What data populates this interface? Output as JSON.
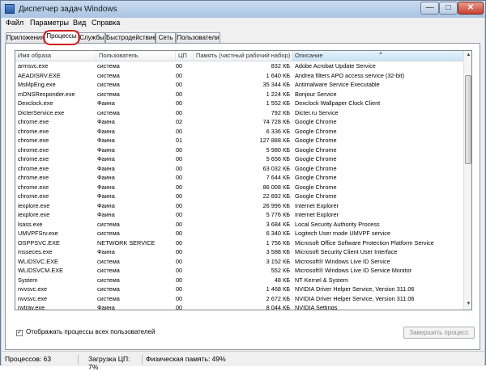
{
  "window": {
    "title": "Диспетчер задач Windows",
    "min": "—",
    "max": "□",
    "close": "✕"
  },
  "menu": [
    "Файл",
    "Параметры",
    "Вид",
    "Справка"
  ],
  "tabs": [
    "Приложения",
    "Процессы",
    "Службы",
    "Быстродействие",
    "Сеть",
    "Пользователи"
  ],
  "active_tab": "Процессы",
  "columns": {
    "name": "Имя образа",
    "user": "Пользователь",
    "cpu": "ЦП",
    "mem": "Память (частный рабочий набор)",
    "desc": "Описание"
  },
  "processes": [
    [
      "armsvc.exe",
      "система",
      "00",
      "832 КБ",
      "Adobe Acrobat Update Service"
    ],
    [
      "AEADISRV.EXE",
      "система",
      "00",
      "1 640 КБ",
      "Andrea filters APO access service (32-bit)"
    ],
    [
      "MsMpEng.exe",
      "система",
      "00",
      "35 344 КБ",
      "Antimalware Service Executable"
    ],
    [
      "mDNSResponder.exe",
      "система",
      "00",
      "1 224 КБ",
      "Bonjour Service"
    ],
    [
      "Dexclock.exe",
      "Фаина",
      "00",
      "1 552 КБ",
      "Dexclock Wallpaper Clock Client"
    ],
    [
      "DicterService.exe",
      "система",
      "00",
      "792 КБ",
      "Dicter.ru Service"
    ],
    [
      "chrome.exe",
      "Фаина",
      "02",
      "74 728 КБ",
      "Google Chrome"
    ],
    [
      "chrome.exe",
      "Фаина",
      "00",
      "6 336 КБ",
      "Google Chrome"
    ],
    [
      "chrome.exe",
      "Фаина",
      "01",
      "127 888 КБ",
      "Google Chrome"
    ],
    [
      "chrome.exe",
      "Фаина",
      "00",
      "5 980 КБ",
      "Google Chrome"
    ],
    [
      "chrome.exe",
      "Фаина",
      "00",
      "5 656 КБ",
      "Google Chrome"
    ],
    [
      "chrome.exe",
      "Фаина",
      "00",
      "63 032 КБ",
      "Google Chrome"
    ],
    [
      "chrome.exe",
      "Фаина",
      "00",
      "7 644 КБ",
      "Google Chrome"
    ],
    [
      "chrome.exe",
      "Фаина",
      "00",
      "86 008 КБ",
      "Google Chrome"
    ],
    [
      "chrome.exe",
      "Фаина",
      "00",
      "22 892 КБ",
      "Google Chrome"
    ],
    [
      "iexplore.exe",
      "Фаина",
      "00",
      "26 996 КБ",
      "Internet Explorer"
    ],
    [
      "iexplore.exe",
      "Фаина",
      "00",
      "5 776 КБ",
      "Internet Explorer"
    ],
    [
      "lsass.exe",
      "система",
      "00",
      "3 684 КБ",
      "Local Security Authority Process"
    ],
    [
      "UMVPFSrv.exe",
      "система",
      "00",
      "6 340 КБ",
      "Logitech User mode UMVPF service"
    ],
    [
      "OSPPSVC.EXE",
      "NETWORK SERVICE",
      "00",
      "1 756 КБ",
      "Microsoft Office Software Protection Platform Service"
    ],
    [
      "msseces.exe",
      "Фаина",
      "00",
      "3 588 КБ",
      "Microsoft Security Client User Interface"
    ],
    [
      "WLIDSVC.EXE",
      "система",
      "00",
      "3 152 КБ",
      "Microsoft® Windows Live ID Service"
    ],
    [
      "WLIDSVCM.EXE",
      "система",
      "00",
      "552 КБ",
      "Microsoft® Windows Live ID Service Monitor"
    ],
    [
      "System",
      "система",
      "00",
      "48 КБ",
      "NT Kernel & System"
    ],
    [
      "nvvsvc.exe",
      "система",
      "00",
      "1 468 КБ",
      "NVIDIA Driver Helper Service, Version 311.06"
    ],
    [
      "nvvsvc.exe",
      "система",
      "00",
      "2 672 КБ",
      "NVIDIA Driver Helper Service, Version 311.06"
    ],
    [
      "nvtray.exe",
      "Фаина",
      "00",
      "8 044 КБ",
      "NVIDIA Settings"
    ]
  ],
  "show_all_checkbox": {
    "label": "Отображать процессы всех пользователей",
    "checked": true
  },
  "end_process_button": "Завершить процесс",
  "status": {
    "processes": "Процессов: 63",
    "cpu": "Загрузка ЦП: 7%",
    "memory": "Физическая память: 49%"
  },
  "icons": {
    "sort": "sort-up-icon",
    "scroll_up": "arrow-up-icon",
    "scroll_down": "arrow-down-icon"
  }
}
